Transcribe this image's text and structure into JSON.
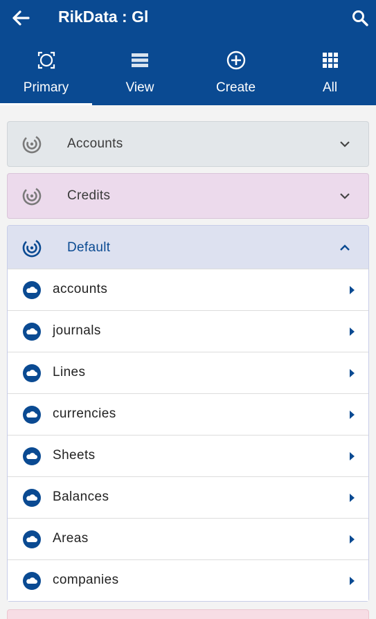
{
  "header": {
    "title": "RikData : Gl",
    "back_icon": "arrow-left-icon",
    "search_icon": "search-icon",
    "background": "#0a4a92"
  },
  "tabs": [
    {
      "label": "Primary",
      "icon": "target-scan-icon",
      "active": true
    },
    {
      "label": "View",
      "icon": "list-icon",
      "active": false
    },
    {
      "label": "Create",
      "icon": "plus-circle-icon",
      "active": false
    },
    {
      "label": "All",
      "icon": "grid-icon",
      "active": false
    }
  ],
  "groups": {
    "accounts": {
      "label": "Accounts",
      "expanded": false,
      "color": "#e3e7ea"
    },
    "credits": {
      "label": "Credits",
      "expanded": false,
      "color": "#ecdaec"
    },
    "default": {
      "label": "Default",
      "expanded": true,
      "color": "#dde1f0",
      "items": [
        {
          "label": "accounts"
        },
        {
          "label": "journals"
        },
        {
          "label": "Lines"
        },
        {
          "label": "currencies"
        },
        {
          "label": "Sheets"
        },
        {
          "label": "Balances"
        },
        {
          "label": "Areas"
        },
        {
          "label": "companies"
        }
      ]
    }
  }
}
